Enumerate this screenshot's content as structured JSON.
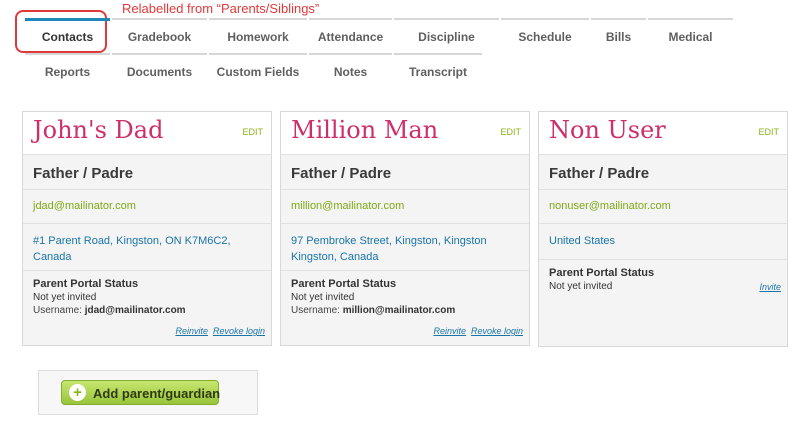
{
  "annotation": "Relabelled from “Parents/Siblings”",
  "tabs_row1": [
    {
      "label": "Contacts",
      "active": true
    },
    {
      "label": "Gradebook"
    },
    {
      "label": "Homework"
    },
    {
      "label": "Attendance"
    },
    {
      "label": "Discipline"
    },
    {
      "label": "Schedule"
    },
    {
      "label": "Bills"
    },
    {
      "label": "Medical"
    }
  ],
  "tabs_row2": [
    {
      "label": "Reports"
    },
    {
      "label": "Documents"
    },
    {
      "label": "Custom Fields"
    },
    {
      "label": "Notes"
    },
    {
      "label": "Transcript"
    }
  ],
  "cards": [
    {
      "name": "John's Dad",
      "edit": "EDIT",
      "relationship": "Father / Padre",
      "email": "jdad@mailinator.com",
      "address": "#1 Parent Road, Kingston, ON K7M6C2, Canada",
      "portal_heading": "Parent Portal Status",
      "status": "Not yet invited",
      "username_label": "Username:",
      "username": "jdad@mailinator.com",
      "reinvite": "Reinvite",
      "revoke": "Revoke login"
    },
    {
      "name": "Million Man",
      "edit": "EDIT",
      "relationship": "Father / Padre",
      "email": "million@mailinator.com",
      "address": "97 Pembroke Street, Kingston, Kingston Kingston, Canada",
      "portal_heading": "Parent Portal Status",
      "status": "Not yet invited",
      "username_label": "Username:",
      "username": "million@mailinator.com",
      "reinvite": "Reinvite",
      "revoke": "Revoke login"
    },
    {
      "name": "Non User",
      "edit": "EDIT",
      "relationship": "Father / Padre",
      "email": "nonuser@mailinator.com",
      "address": "United States",
      "portal_heading": "Parent Portal Status",
      "status": "Not yet invited",
      "invite": "Invite"
    }
  ],
  "add_button": "Add parent/guardian",
  "colors": {
    "accent_pink": "#cc2f6b",
    "link_blue": "#1a74a8",
    "green": "#8ab317",
    "annotation_red": "#e0393a"
  }
}
